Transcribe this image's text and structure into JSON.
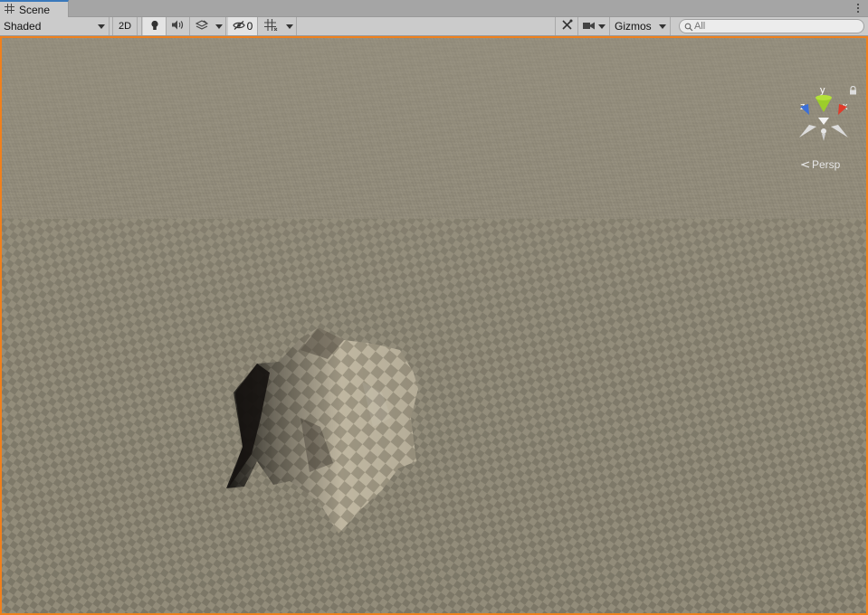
{
  "tab": {
    "title": "Scene",
    "icon": "grid-icon"
  },
  "toolbar": {
    "draw_mode": "Shaded",
    "two_d": "2D",
    "hidden_count": "0",
    "gizmos": "Gizmos",
    "search_placeholder": "All"
  },
  "gizmo": {
    "y": "y",
    "x": "x",
    "z": "z"
  },
  "view": {
    "projection": "Persp"
  },
  "colors": {
    "accent": "#f0801c",
    "tab_highlight": "#3a79bb",
    "axis_x": "#e03b2a",
    "axis_y": "#9ccd2a",
    "axis_z": "#3b6fd8"
  }
}
